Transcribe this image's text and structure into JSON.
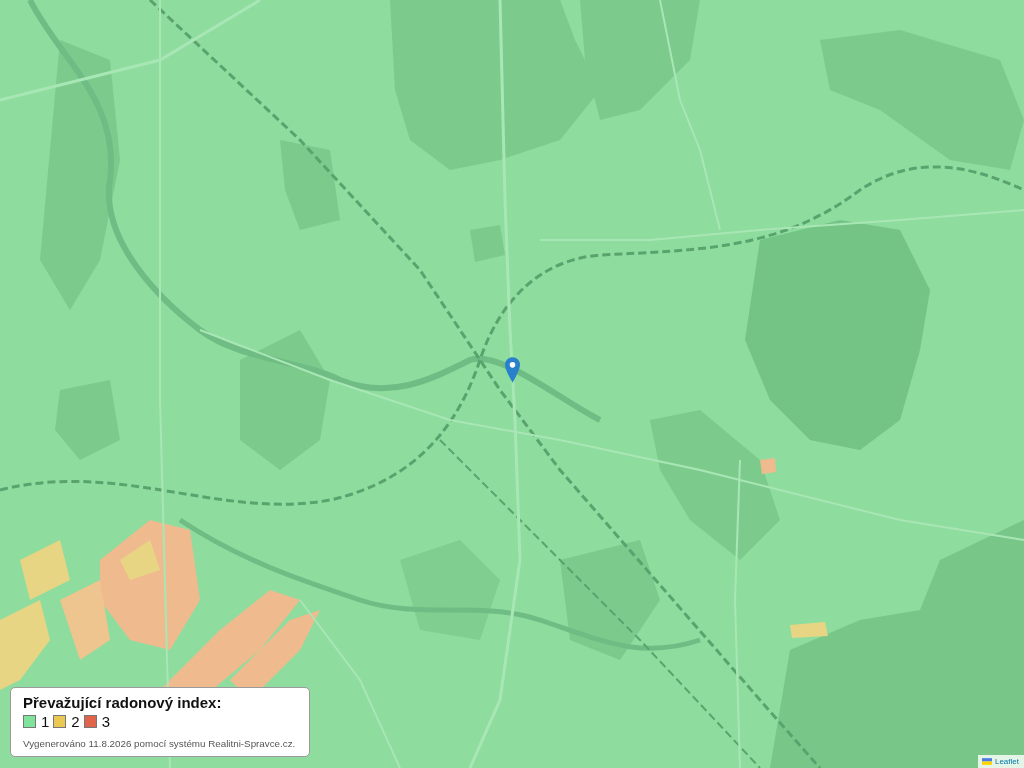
{
  "legend": {
    "title": "Převažující radonový index:",
    "items": [
      {
        "label": "1",
        "color": "#7fe39b"
      },
      {
        "label": "2",
        "color": "#ebc853"
      },
      {
        "label": "3",
        "color": "#e0644c"
      }
    ],
    "note": "Vygenerováno 11.8.2026 pomocí systému Realitni-Spravce.cz."
  },
  "attribution": {
    "link": "Leaflet"
  }
}
